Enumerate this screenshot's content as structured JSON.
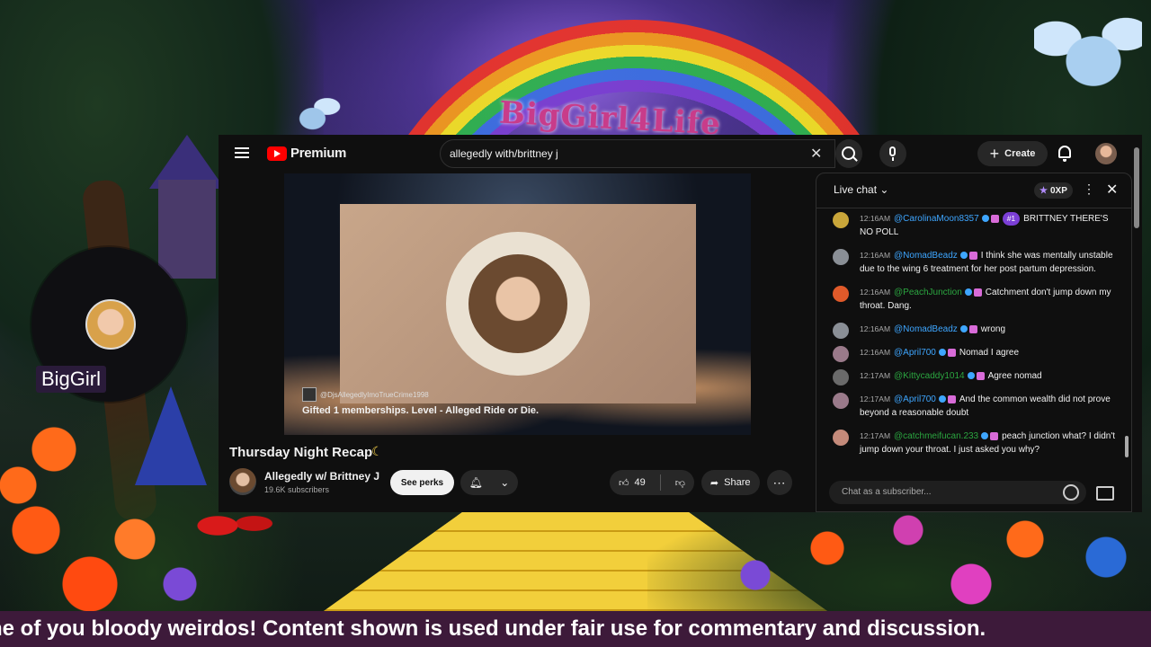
{
  "overlay": {
    "channel_title": "BigGirl4Life",
    "cam_name": "BigGirl",
    "ticker_text": "ne of you bloody weirdos! Content shown is used under fair use for commentary and discussion."
  },
  "youtube": {
    "logo_text": "Premium",
    "search_query": "allegedly with/brittney j",
    "create_label": "Create",
    "player": {
      "channel_handle": "@DjsAllegedlyImoTrueCrime1998",
      "overlay_text": "Gifted 1 memberships. Level - Alleged Ride or Die."
    },
    "video_title": "Thursday Night Recap",
    "channel": {
      "name": "Allegedly w/ Brittney J",
      "subscribers": "19.6K subscribers"
    },
    "perks_label": "See perks",
    "like_count": "49",
    "share_label": "Share"
  },
  "chat": {
    "title": "Live chat",
    "xp": "0XP",
    "messages": [
      {
        "time": "12:16AM",
        "author": "@CarolinaMoon8357",
        "rank": "#1",
        "text": "BRITTNEY THERE'S NO POLL",
        "avatar_color": "#c9a63a"
      },
      {
        "time": "12:16AM",
        "author": "@NomadBeadz",
        "text": "I think she was mentally unstable due to the wing 6 treatment for her post partum depression.",
        "avatar_color": "#8a8f96"
      },
      {
        "time": "12:16AM",
        "author": "@PeachJunction",
        "text": "Catchment don't jump down my throat. Dang.",
        "avatar_color": "#e05a2a"
      },
      {
        "time": "12:16AM",
        "author": "@NomadBeadz",
        "text": "wrong",
        "avatar_color": "#8a8f96"
      },
      {
        "time": "12:16AM",
        "author": "@April700",
        "text": "Nomad I agree",
        "avatar_color": "#9a7a8a"
      },
      {
        "time": "12:17AM",
        "author": "@Kittycaddy1014",
        "text": "Agree nomad",
        "avatar_color": "#6a6a6a"
      },
      {
        "time": "12:17AM",
        "author": "@April700",
        "text": "And the common wealth did not prove beyond a reasonable doubt",
        "avatar_color": "#9a7a8a"
      },
      {
        "time": "12:17AM",
        "author": "@catchmeifucan.233",
        "text": "peach junction what? I didn't jump down your throat. I just asked you why?",
        "avatar_color": "#c48a7a"
      }
    ],
    "input_placeholder": "Chat as a subscriber..."
  },
  "icons": {
    "menu": "hamburger-icon",
    "search": "search-icon",
    "mic": "mic-icon",
    "notifications": "bell-icon",
    "like": "thumbs-up-icon",
    "dislike": "thumbs-down-icon",
    "share": "share-icon",
    "emoji": "emoji-icon",
    "super_chat": "money-icon"
  },
  "colors": {
    "youtube_red": "#ff0000",
    "chat_author": "#3ea6ff",
    "rank_badge": "#7b3fd6",
    "ticker_bg": "#3d1a3a"
  }
}
